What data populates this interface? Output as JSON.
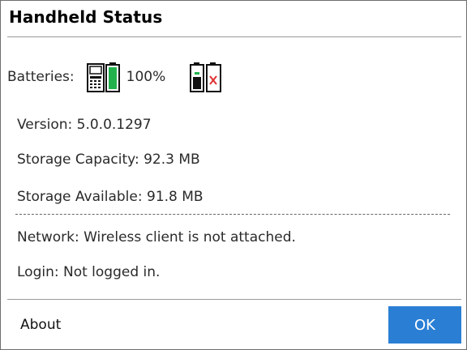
{
  "title": "Handheld Status",
  "batteries": {
    "label": "Batteries:",
    "handheld_percent": "100%",
    "handheld_icon": "handheld-battery-full-icon",
    "handheld_level": 1.0,
    "pack_icon": "battery-pack-missing-icon",
    "colors": {
      "full": "#22b14c",
      "missing": "#e03030"
    }
  },
  "info": {
    "version": "Version: 5.0.0.1297",
    "storage_capacity": "Storage Capacity: 92.3 MB",
    "storage_available": "Storage Available: 91.8 MB",
    "network": "Network: Wireless client is not attached.",
    "login": "Login: Not logged in."
  },
  "footer": {
    "about_label": "About",
    "ok_label": "OK",
    "ok_color": "#2a7fd4"
  }
}
